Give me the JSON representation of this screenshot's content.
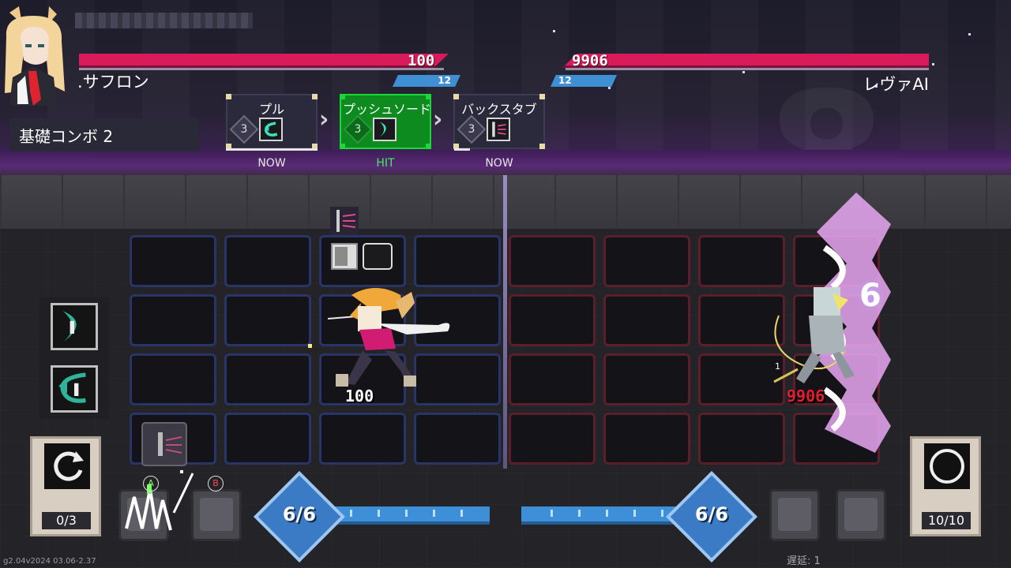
{
  "player": {
    "name": ".サフロン",
    "hp": "100",
    "shield": "12",
    "unit_hp": "100"
  },
  "enemy": {
    "name": "レヴァAI",
    "hp": "9906",
    "shield": "12",
    "unit_hp": "9906",
    "hit_count": "6",
    "small_marker": "1"
  },
  "combo": {
    "title": "基礎コンボ 2",
    "cards": [
      {
        "name": "プル",
        "cost": "3",
        "status": "NOW"
      },
      {
        "name": "プッシュソード",
        "cost": "3",
        "status": "HIT"
      },
      {
        "name": "バックスタブ",
        "cost": "3",
        "status": "NOW"
      }
    ]
  },
  "hud": {
    "player_deck_count": "0/3",
    "enemy_deck_count": "10/10",
    "player_energy": "6/6",
    "enemy_energy": "6/6",
    "button_a": "A",
    "button_b": "B",
    "delay": "遅延: 1",
    "version": "g2.04v2024 03.06-2.37"
  },
  "colors": {
    "hp": "#d91a5b",
    "shield": "#3f8fd4",
    "energy": "#3d8fd8",
    "hit_card": "#0e8b1f",
    "player_grid": "#283566",
    "enemy_grid": "#5a1f2a"
  }
}
